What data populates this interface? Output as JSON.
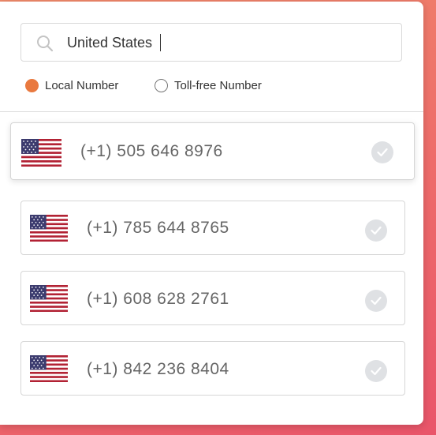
{
  "search": {
    "value": "United States"
  },
  "number_type": {
    "options": [
      {
        "label": "Local Number",
        "selected": true
      },
      {
        "label": "Toll-free Number",
        "selected": false
      }
    ]
  },
  "numbers": [
    {
      "country_flag": "us-flag-icon",
      "phone": "(+1) 505 646 8976"
    },
    {
      "country_flag": "us-flag-icon",
      "phone": "(+1) 785 644 8765"
    },
    {
      "country_flag": "us-flag-icon",
      "phone": "(+1) 608 628 2761"
    },
    {
      "country_flag": "us-flag-icon",
      "phone": "(+1) 842 236 8404"
    }
  ],
  "colors": {
    "accent": "#e9793f",
    "check_bg": "#dfe1e4",
    "background_gradient": [
      "#f08a6a",
      "#e9556a"
    ]
  }
}
